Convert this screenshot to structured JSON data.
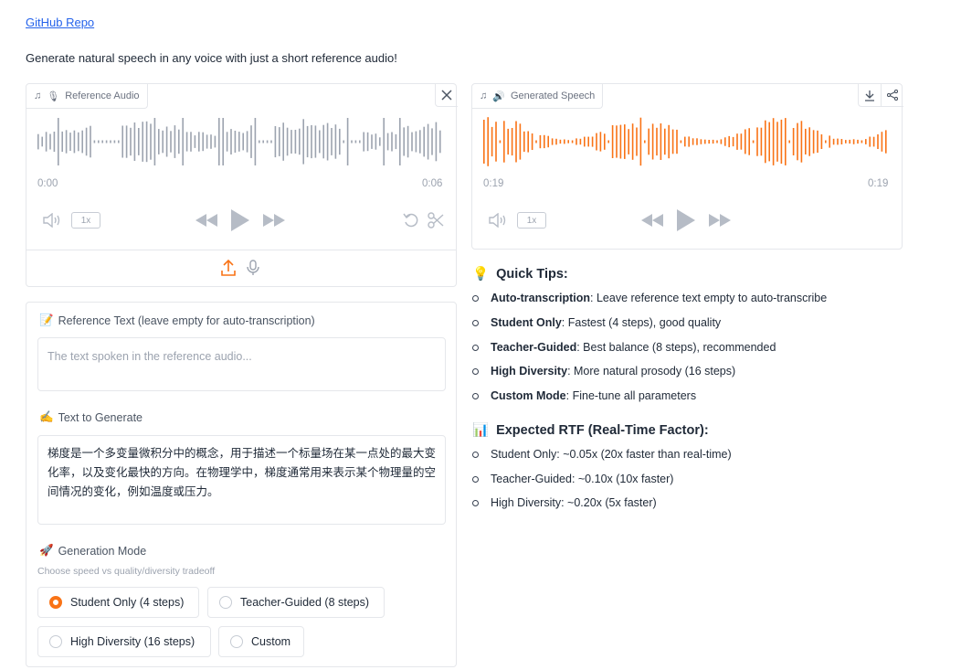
{
  "header": {
    "repo_link": "GitHub Repo",
    "subtitle": "Generate natural speech in any voice with just a short reference audio!"
  },
  "reference_audio": {
    "label": "Reference Audio",
    "label_icon": "music-note-icon",
    "emoji": "🎙",
    "time_start": "0:00",
    "time_end": "0:06",
    "speed": "1x",
    "waveform_color": "#9ca3af"
  },
  "generated_speech": {
    "label": "Generated Speech",
    "emoji": "🔊",
    "time_start": "0:19",
    "time_end": "0:19",
    "speed": "1x",
    "waveform_color": "#f97316"
  },
  "reference_text": {
    "emoji": "📝",
    "label": "Reference Text (leave empty for auto-transcription)",
    "placeholder": "The text spoken in the reference audio..."
  },
  "text_to_generate": {
    "emoji": "✍️",
    "label": "Text to Generate",
    "value": "梯度是一个多变量微积分中的概念，用于描述一个标量场在某一点处的最大变化率，以及变化最快的方向。在物理学中，梯度通常用来表示某个物理量的空间情况的变化，例如温度或压力。"
  },
  "generation_mode": {
    "emoji": "🚀",
    "label": "Generation Mode",
    "info": "Choose speed vs quality/diversity tradeoff",
    "options": [
      {
        "label": "Student Only (4 steps)",
        "selected": true
      },
      {
        "label": "Teacher-Guided (8 steps)",
        "selected": false
      },
      {
        "label": "High Diversity (16 steps)",
        "selected": false
      },
      {
        "label": "Custom",
        "selected": false
      }
    ],
    "accent": "#f97316"
  },
  "quick_tips": {
    "emoji": "💡",
    "title": "Quick Tips:",
    "items": [
      {
        "bold": "Auto-transcription",
        "text": ": Leave reference text empty to auto-transcribe"
      },
      {
        "bold": "Student Only",
        "text": ": Fastest (4 steps), good quality"
      },
      {
        "bold": "Teacher-Guided",
        "text": ": Best balance (8 steps), recommended"
      },
      {
        "bold": "High Diversity",
        "text": ": More natural prosody (16 steps)"
      },
      {
        "bold": "Custom Mode",
        "text": ": Fine-tune all parameters"
      }
    ]
  },
  "rtf": {
    "emoji": "📊",
    "title": "Expected RTF (Real-Time Factor):",
    "items": [
      "Student Only: ~0.05x (20x faster than real-time)",
      "Teacher-Guided: ~0.10x (10x faster)",
      "High Diversity: ~0.20x (5x faster)"
    ]
  }
}
